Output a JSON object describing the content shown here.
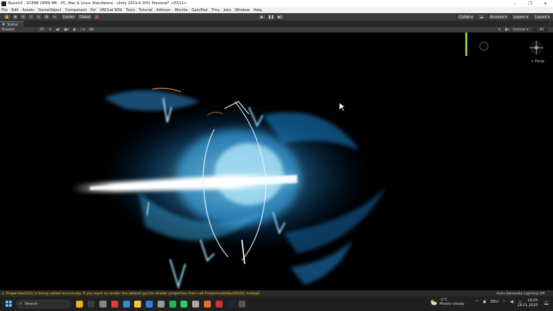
{
  "window": {
    "title": "RuneV2 - SCENE OPEN ME - PC, Mac & Linux Standalone - Unity 2019.4.30f1 Personal* <DX11>",
    "minimize": "–",
    "maximize": "❐",
    "close": "✕"
  },
  "menu": [
    "File",
    "Edit",
    "Assets",
    "GameObject",
    "Component",
    "Poi",
    "VRChat SDK",
    "Tools",
    "Tutorial",
    "Arktoon",
    "Mochie",
    "GatoTool",
    "Thry",
    "Jobs",
    "Window",
    "Help"
  ],
  "toolbar": {
    "center_label": "Center",
    "global_label": "Global",
    "collab_label": "Collab ▾",
    "account_label": "Account ▾",
    "layers_label": "Layers ▾",
    "layout_label": "Layout ▾"
  },
  "tabs": {
    "scene_label": "Scene"
  },
  "scene_toolbar": {
    "shading": "Shaded",
    "mode_2d": "2D",
    "gizmos_label": "Gizmos ▾",
    "search_glyph": "◌All"
  },
  "viewport": {
    "persp_label": "< Persp"
  },
  "status": {
    "message": "PropertiesGUI() is being called recursively. If you want to render the default gui for shader properties then call PropertiesDefaultGUI() instead",
    "right": "Auto Generate Lighting Off"
  },
  "taskbar": {
    "search_placeholder": "Search",
    "apps": [
      {
        "name": "app-explorer-icon",
        "color": "#f2b01e"
      },
      {
        "name": "app-terminal-icon",
        "color": "#3a3a3a"
      },
      {
        "name": "app-unity-icon",
        "color": "#888888"
      },
      {
        "name": "app-media-icon",
        "color": "#e03a3a"
      },
      {
        "name": "app-edge-icon",
        "color": "#2b8fd6"
      },
      {
        "name": "app-folder-icon",
        "color": "#f5c542"
      },
      {
        "name": "app-chrome-icon",
        "color": "#2f7fd6"
      },
      {
        "name": "app-gear-icon",
        "color": "#999999"
      },
      {
        "name": "app-spotify-icon",
        "color": "#1db954"
      },
      {
        "name": "app-whatsapp-icon",
        "color": "#25d366"
      },
      {
        "name": "app-vscode-icon",
        "color": "#aaaaaa"
      },
      {
        "name": "app-firefox-icon",
        "color": "#e76e2c"
      },
      {
        "name": "app-blender-icon",
        "color": "#cc3333"
      },
      {
        "name": "app-steam-icon",
        "color": "#1b2838"
      },
      {
        "name": "app-unity-hub-icon",
        "color": "#555555"
      }
    ],
    "weather_temp": "-1°C",
    "weather_desc": "Mostly cloudy",
    "tray_chevron": "^",
    "language": "DEU",
    "time": "18:05",
    "date": "18.01.2025"
  }
}
